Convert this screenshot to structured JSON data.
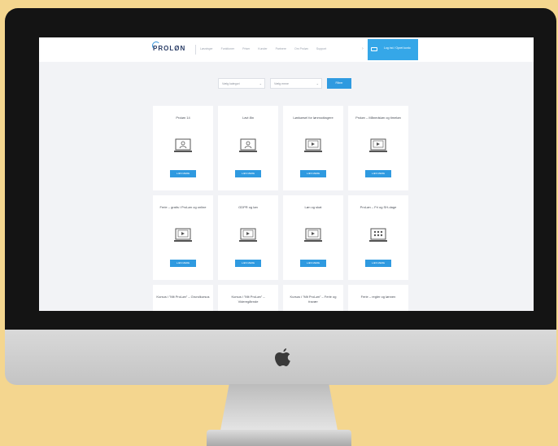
{
  "brand": {
    "logo_text": "PROLØN"
  },
  "nav": {
    "items": [
      "Løsninger",
      "Funktioner",
      "Priser",
      "Kunder",
      "Partnere",
      "Om Proløn",
      "Support"
    ],
    "cta_label": "Log ind / Opret konto"
  },
  "filters": {
    "filter1": "Vælg kategori",
    "filter2": "Vælg emne",
    "button_label": "Filtrer"
  },
  "cards": [
    {
      "title": "Proløn 14",
      "icon": "monitor-person-icon",
      "button": "LÆS MERE"
    },
    {
      "title": "Lavt lån",
      "icon": "monitor-person-icon",
      "button": "LÆS MERE"
    },
    {
      "title": "Lønkørsel for lønmodtagere",
      "icon": "monitor-video-icon",
      "button": "LÆS MERE"
    },
    {
      "title": "Proløn – Månedsløn og timeløn",
      "icon": "monitor-video-icon",
      "button": "LÆS MERE"
    },
    {
      "title": "Ferie – gratis i ProLøn og online",
      "icon": "monitor-video-icon",
      "button": "LÆS MERE"
    },
    {
      "title": "GDPR og løn",
      "icon": "monitor-video-icon",
      "button": "LÆS MERE"
    },
    {
      "title": "Løn og skat",
      "icon": "monitor-video-icon",
      "button": "LÆS MERE"
    },
    {
      "title": "ProLøn – Fri og SH-dage",
      "icon": "monitor-audience-icon",
      "button": "LÆS MERE"
    },
    {
      "title": "Kursus i ”Mit ProLøn” – Grundkursus",
      "icon": "",
      "button": ""
    },
    {
      "title": "Kursus i ”Mit ProLøn” – Videregående",
      "icon": "",
      "button": ""
    },
    {
      "title": "Kursus i ”Mit ProLøn” – Ferie og fravær",
      "icon": "",
      "button": ""
    },
    {
      "title": "Ferie – regler og lønnen",
      "icon": "",
      "button": ""
    }
  ]
}
